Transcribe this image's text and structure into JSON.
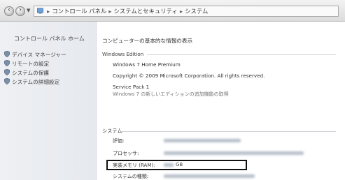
{
  "addressbar": {
    "breadcrumb": [
      "コントロール パネル",
      "システムとセキュリティ",
      "システム"
    ],
    "icons": {
      "back": "back-arrow-icon",
      "forward": "forward-arrow-icon",
      "history": "history-dropdown-icon",
      "location": "control-panel-icon"
    }
  },
  "sidebar": {
    "home_label": "コントロール パネル ホーム",
    "items": [
      {
        "label": "デバイス マネージャー",
        "icon": "shield-icon"
      },
      {
        "label": "リモートの設定",
        "icon": "shield-icon"
      },
      {
        "label": "システムの保護",
        "icon": "shield-icon"
      },
      {
        "label": "システムの詳細設定",
        "icon": "shield-icon"
      }
    ]
  },
  "main": {
    "title": "コンピューターの基本的な情報の表示",
    "windows_edition": {
      "heading": "Windows Edition",
      "edition": "Windows 7 Home Premium",
      "copyright": "Copyright © 2009 Microsoft Corporation.  All rights reserved.",
      "service_pack": "Service Pack 1",
      "upgrade_link": "Windows 7 の新しいエディションの追加機能の取得"
    },
    "system": {
      "heading": "システム",
      "rating_label": "評価:",
      "processor_label": "プロセッサ:",
      "ram_label": "実装メモリ (RAM):",
      "ram_unit": "GB",
      "type_label": "システムの種類:"
    }
  },
  "colors": {
    "highlight_border": "#111111",
    "sidebar_bg": "#eef0f3"
  }
}
